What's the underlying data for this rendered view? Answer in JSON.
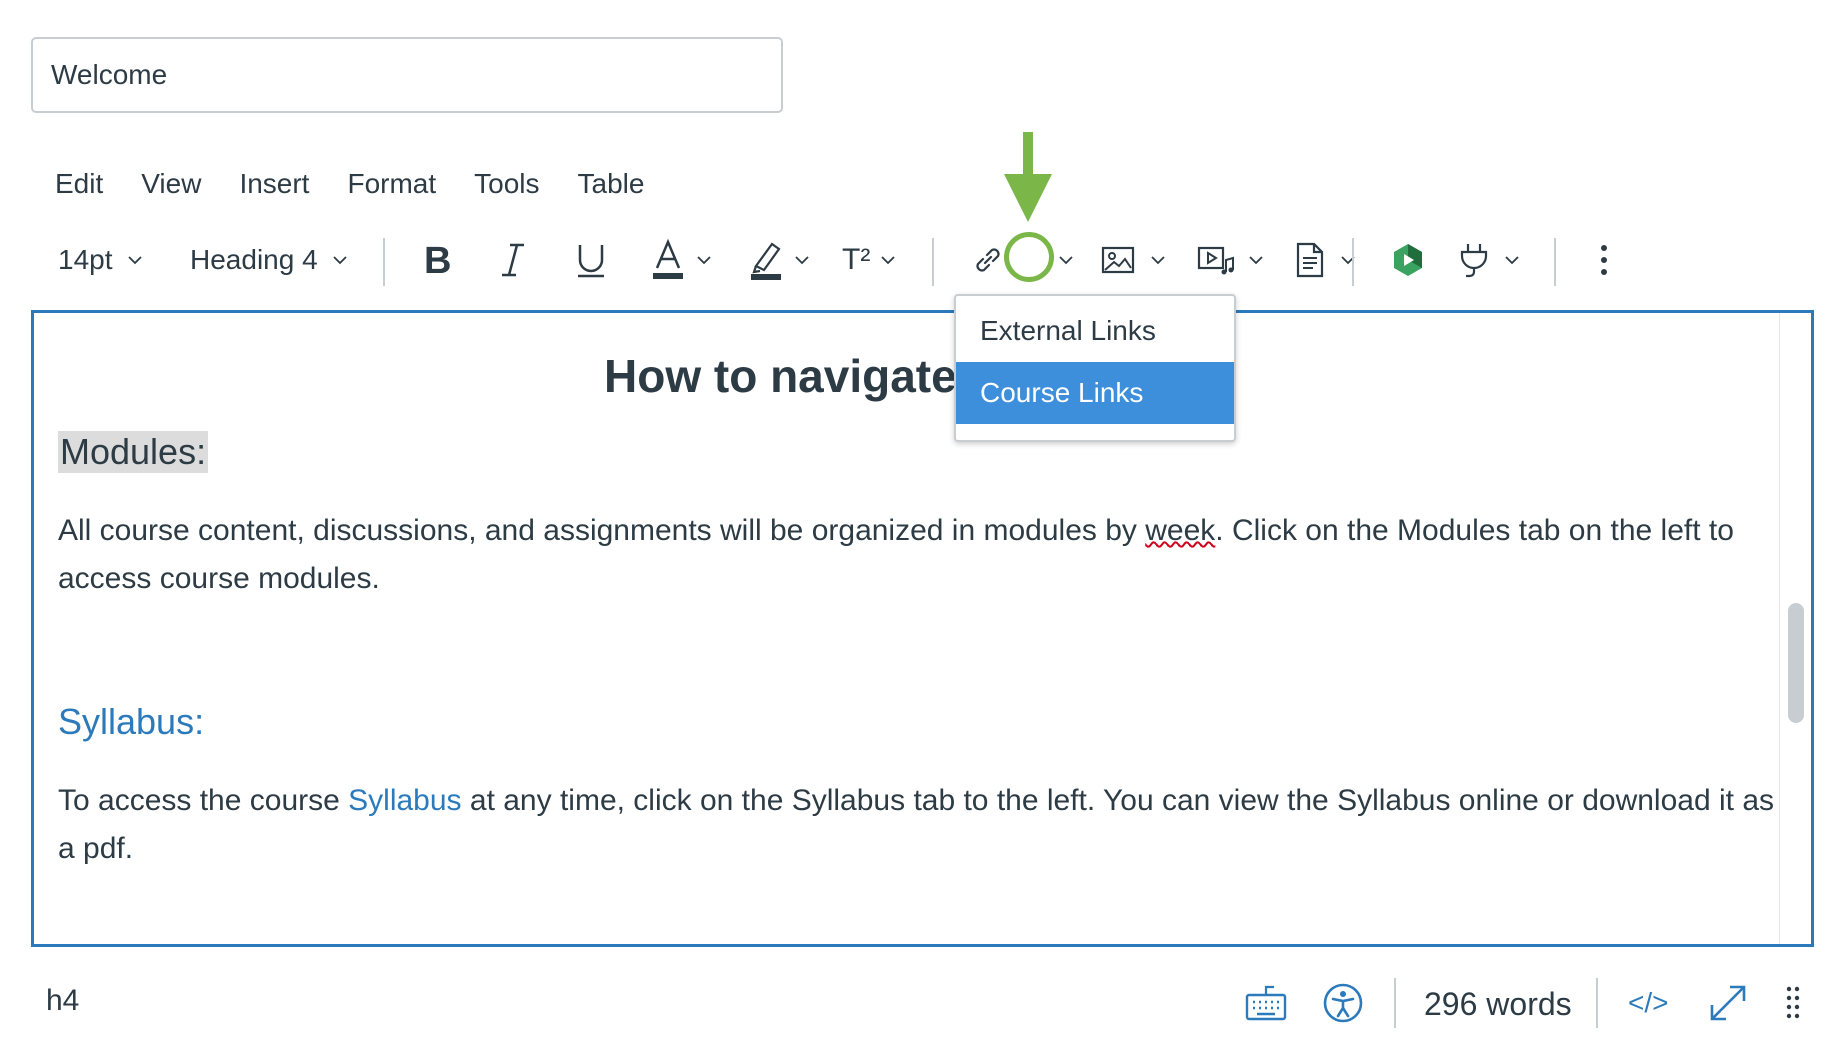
{
  "title_field": {
    "value": "Welcome"
  },
  "menubar": {
    "items": [
      "Edit",
      "View",
      "Insert",
      "Format",
      "Tools",
      "Table"
    ]
  },
  "toolbar": {
    "font_size": "14pt",
    "block_format": "Heading 4",
    "superscript_glyph": "T²",
    "icons": [
      "bold-icon",
      "italic-icon",
      "underline-icon",
      "text-color-icon",
      "highlight-icon",
      "superscript-icon",
      "link-icon",
      "image-icon",
      "media-icon",
      "document-icon",
      "apps-icon",
      "plug-icon",
      "more-icon"
    ]
  },
  "links_menu": {
    "items": [
      "External Links",
      "Course Links"
    ],
    "selected_index": 1
  },
  "content": {
    "title": "How to navigate",
    "modules_heading": "Modules:",
    "para1_part1": "All course content, discussions, and assignments will be organized in modules by ",
    "para1_misspelled": "week",
    "para1_part2": ". Click on the Modules tab on the left to access course modules.",
    "syllabus_heading": "Syllabus:",
    "para2_part1": "To access the course ",
    "para2_link": "Syllabus",
    "para2_part2": " at any time, click on the Syllabus tab to the left. You can view the Syllabus online or download it as a pdf."
  },
  "statusbar": {
    "element_path": "h4",
    "word_count": "296 words",
    "html_toggle": "</>"
  },
  "colors": {
    "accent_blue": "#2b7abc",
    "menu_selected": "#3d8fdc",
    "annotation_green": "#7ab648",
    "text": "#2d3b45"
  }
}
